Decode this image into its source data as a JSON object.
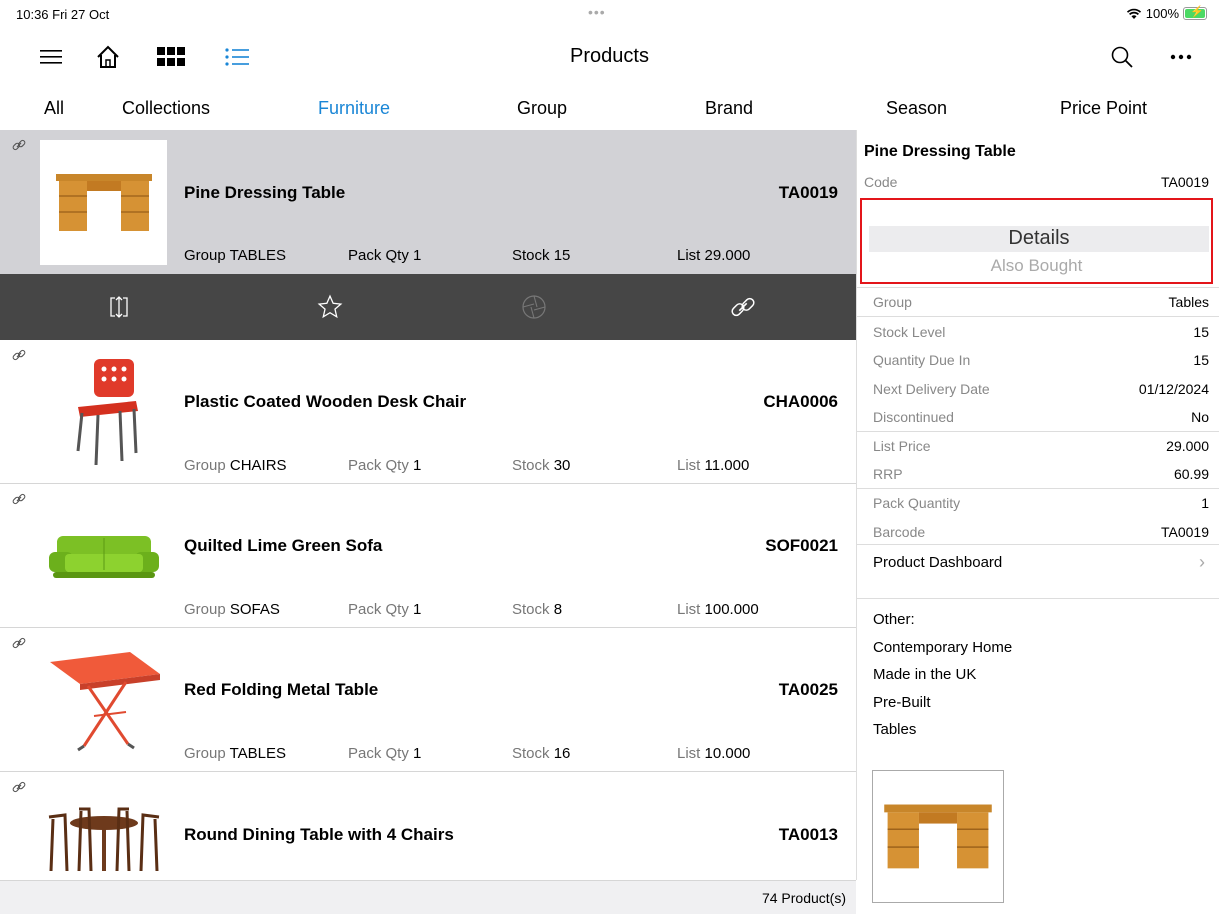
{
  "status": {
    "time": "10:36  Fri 27 Oct",
    "dots": "•••",
    "battery": "100%"
  },
  "header": {
    "title": "Products"
  },
  "tabs": [
    {
      "label": "All"
    },
    {
      "label": "Collections"
    },
    {
      "label": "Furniture",
      "active": true
    },
    {
      "label": "Group"
    },
    {
      "label": "Brand"
    },
    {
      "label": "Season"
    },
    {
      "label": "Price Point"
    }
  ],
  "labels": {
    "group": "Group",
    "pack_qty": "Pack Qty",
    "stock": "Stock",
    "list": "List"
  },
  "products": [
    {
      "name": "Pine Dressing Table",
      "code": "TA0019",
      "group": "TABLES",
      "pack_qty": "1",
      "stock": "15",
      "list": "29.000"
    },
    {
      "name": "Plastic Coated Wooden Desk Chair",
      "code": "CHA0006",
      "group": "CHAIRS",
      "pack_qty": "1",
      "stock": "30",
      "list": "11.000"
    },
    {
      "name": "Quilted Lime Green Sofa",
      "code": "SOF0021",
      "group": "SOFAS",
      "pack_qty": "1",
      "stock": "8",
      "list": "100.000"
    },
    {
      "name": "Red Folding Metal Table",
      "code": "TA0025",
      "group": "TABLES",
      "pack_qty": "1",
      "stock": "16",
      "list": "10.000"
    },
    {
      "name": "Round Dining Table with 4 Chairs",
      "code": "TA0013"
    }
  ],
  "footer": {
    "count": "74 Product(s)"
  },
  "detail": {
    "title": "Pine Dressing Table",
    "code_label": "Code",
    "code_value": "TA0019",
    "segment": {
      "details": "Details",
      "also_bought": "Also Bought"
    },
    "rows": [
      {
        "label": "Group",
        "value": "Tables"
      },
      {
        "label": "Stock Level",
        "value": "15"
      },
      {
        "label": "Quantity Due In",
        "value": "15"
      },
      {
        "label": "Next Delivery Date",
        "value": "01/12/2024"
      },
      {
        "label": "Discontinued",
        "value": "No"
      },
      {
        "label": "List Price",
        "value": "29.000"
      },
      {
        "label": "RRP",
        "value": "60.99"
      },
      {
        "label": "Pack Quantity",
        "value": "1"
      },
      {
        "label": "Barcode",
        "value": "TA0019"
      }
    ],
    "dashboard": "Product Dashboard",
    "other_title": "Other:",
    "other_items": [
      "Contemporary Home",
      "Made in the UK",
      "Pre-Built",
      "Tables"
    ]
  },
  "colors": {
    "accent": "#1a86d6",
    "highlight_border": "#e3151a",
    "action_bar": "#464646"
  }
}
